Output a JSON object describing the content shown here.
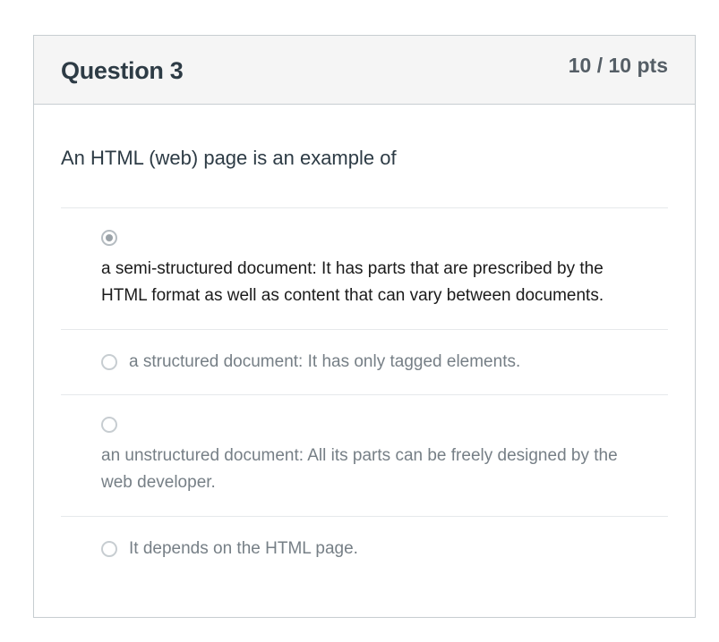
{
  "header": {
    "title": "Question 3",
    "points": "10 / 10 pts"
  },
  "question": {
    "text": "An HTML (web) page is an example of"
  },
  "answers": [
    {
      "label": "a semi-structured document: It has parts that are prescribed by the HTML format as well as content that can vary between documents.",
      "selected": true
    },
    {
      "label": "a structured document: It has only tagged elements.",
      "selected": false
    },
    {
      "label": "an unstructured document: All its parts can be freely designed by the web developer.",
      "selected": false
    },
    {
      "label": "It depends on the HTML page.",
      "selected": false
    }
  ],
  "colors": {
    "title": "#2d3b45",
    "selected_text": "#1b1b1b",
    "unselected_text": "#767f86",
    "header_bg": "#f5f5f5",
    "border": "#c7cdd1"
  }
}
